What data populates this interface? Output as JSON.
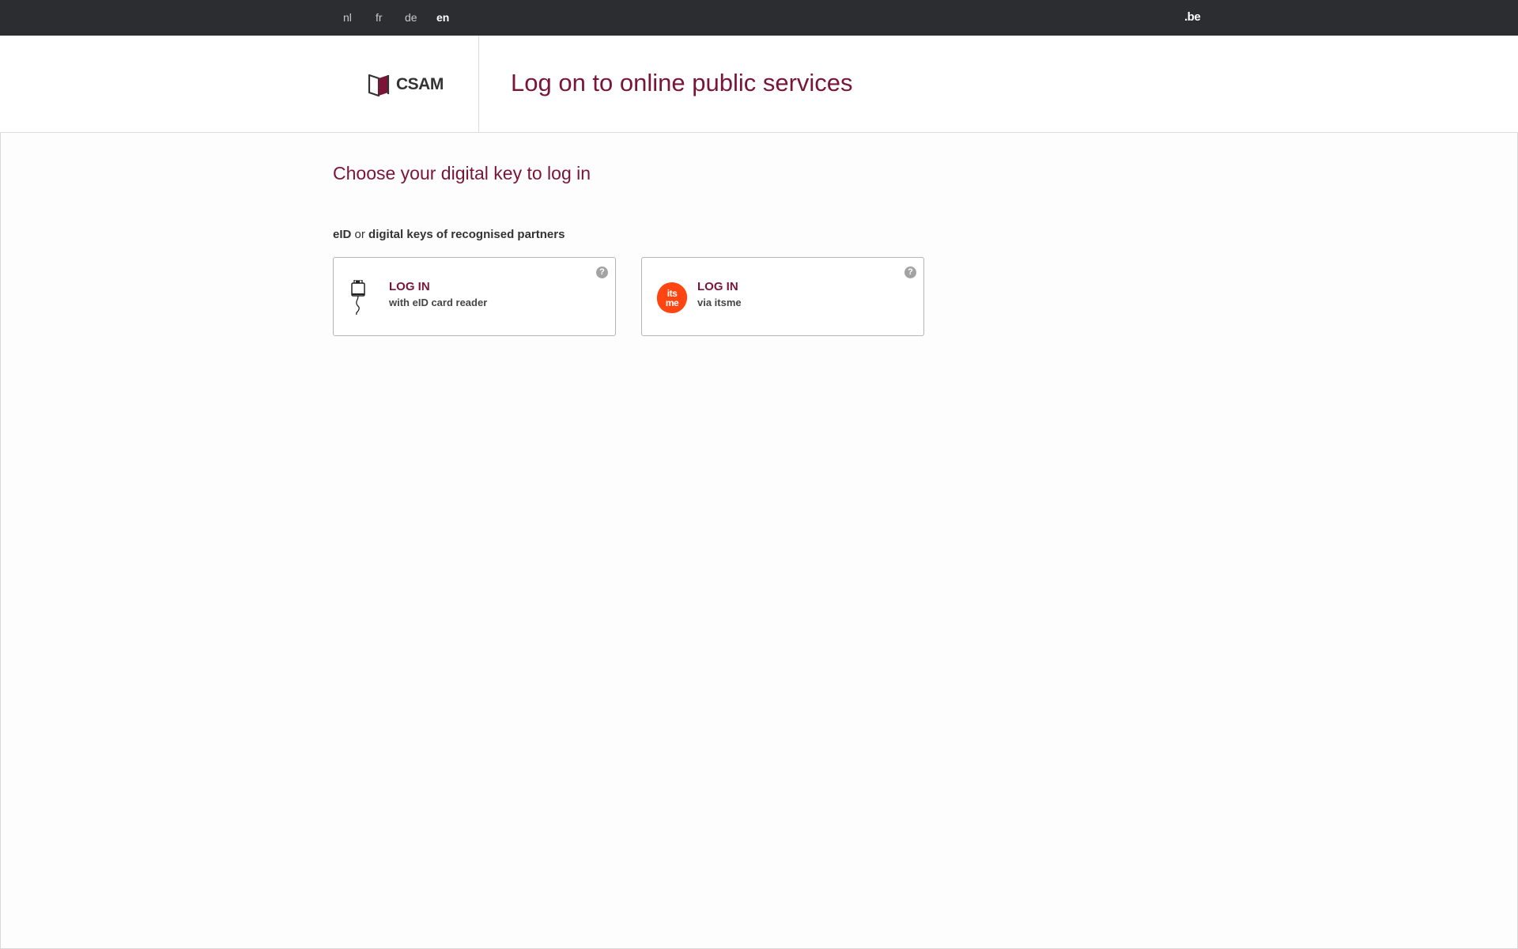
{
  "top_bar": {
    "languages": [
      {
        "code": "nl",
        "active": false
      },
      {
        "code": "fr",
        "active": false
      },
      {
        "code": "de",
        "active": false
      },
      {
        "code": "en",
        "active": true
      }
    ],
    "site_logo": ".be"
  },
  "header": {
    "logo_text": "CSAM",
    "title": "Log on to online public services"
  },
  "main": {
    "title": "Choose your digital key to log in",
    "subtitle": {
      "part1": "eID",
      "part2": " or ",
      "part3": "digital keys of recognised partners"
    },
    "options": [
      {
        "icon": "eid-card-reader-icon",
        "label": "LOG IN",
        "sub": "with eID card reader",
        "help": "?"
      },
      {
        "icon": "itsme-logo",
        "icon_text": "itsme",
        "label": "LOG IN",
        "sub": "via itsme",
        "help": "?"
      }
    ]
  },
  "colors": {
    "accent": "#7a1537",
    "topbar": "#2c2d31",
    "itsme": "#ff4612"
  }
}
